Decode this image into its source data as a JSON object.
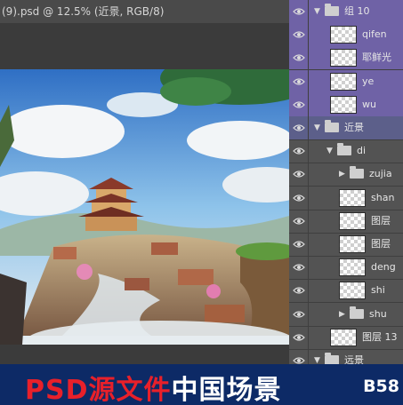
{
  "document": {
    "tab_title": "(9).psd @ 12.5% (近景, RGB/8)"
  },
  "layers_panel": {
    "layers": [
      {
        "name": "组 10",
        "kind": "group",
        "expanded": true
      },
      {
        "name": "qifen",
        "kind": "layer"
      },
      {
        "name": "耶鲜光",
        "kind": "layer"
      },
      {
        "name": "ye",
        "kind": "layer"
      },
      {
        "name": "wu",
        "kind": "layer"
      },
      {
        "name": "近景",
        "kind": "group",
        "expanded": true
      },
      {
        "name": "di",
        "kind": "group",
        "expanded": true
      },
      {
        "name": "zujia",
        "kind": "group",
        "expanded": false
      },
      {
        "name": "shan",
        "kind": "layer"
      },
      {
        "name": "图层",
        "kind": "layer"
      },
      {
        "name": "图层",
        "kind": "layer"
      },
      {
        "name": "deng",
        "kind": "layer"
      },
      {
        "name": "shi",
        "kind": "layer"
      },
      {
        "name": "shu",
        "kind": "group",
        "expanded": false
      },
      {
        "name": "图层 13",
        "kind": "layer"
      },
      {
        "name": "远景",
        "kind": "group",
        "expanded": true
      }
    ]
  },
  "banner": {
    "red_text": "PSD源文件",
    "white_text": "中国场景",
    "code": "B58"
  },
  "colors": {
    "banner_bg": "#0d2a66",
    "banner_red": "#e8202a",
    "selected_layer": "#6f62a6",
    "panel_bg": "#535353"
  },
  "icons": [
    "eye-icon",
    "folder-icon",
    "disclosure-arrow-icon"
  ]
}
